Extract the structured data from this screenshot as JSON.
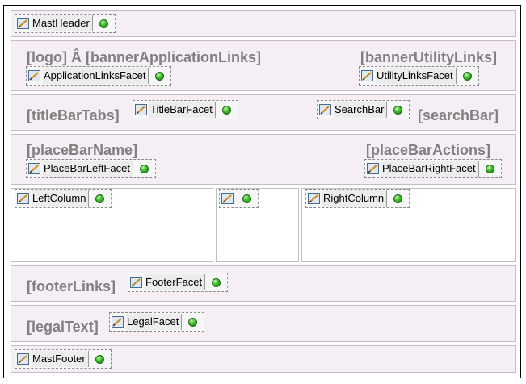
{
  "mast_header": {
    "facet": "MastHeader"
  },
  "banner": {
    "left_text": "[logo] Â  [bannerApplicationLinks]",
    "left_facet": "ApplicationLinksFacet",
    "right_text": "[bannerUtilityLinks]",
    "right_facet": "UtilityLinksFacet"
  },
  "title_bar": {
    "tabs_text": "[titleBarTabs]",
    "title_facet": "TitleBarFacet",
    "search_facet": "SearchBar",
    "search_text": "[searchBar]"
  },
  "place_bar": {
    "name_text": "[placeBarName]",
    "left_facet": "PlaceBarLeftFacet",
    "actions_text": "[placeBarActions]",
    "right_facet": "PlaceBarRightFacet"
  },
  "columns": {
    "left_facet": "LeftColumn",
    "middle_facet": "",
    "right_facet": "RightColumn"
  },
  "footer": {
    "links_text": "[footerLinks]",
    "facet": "FooterFacet"
  },
  "legal": {
    "text": "[legalText]",
    "facet": "LegalFacet"
  },
  "mast_footer": {
    "facet": "MastFooter"
  },
  "colors": {
    "panel_bg": "#f5eef5",
    "placeholder_text": "#808080",
    "status_dot": "#3dbb2b"
  },
  "icons": {
    "facet_icon": "facet-edit-icon",
    "status_icon": "green-dot-icon"
  }
}
